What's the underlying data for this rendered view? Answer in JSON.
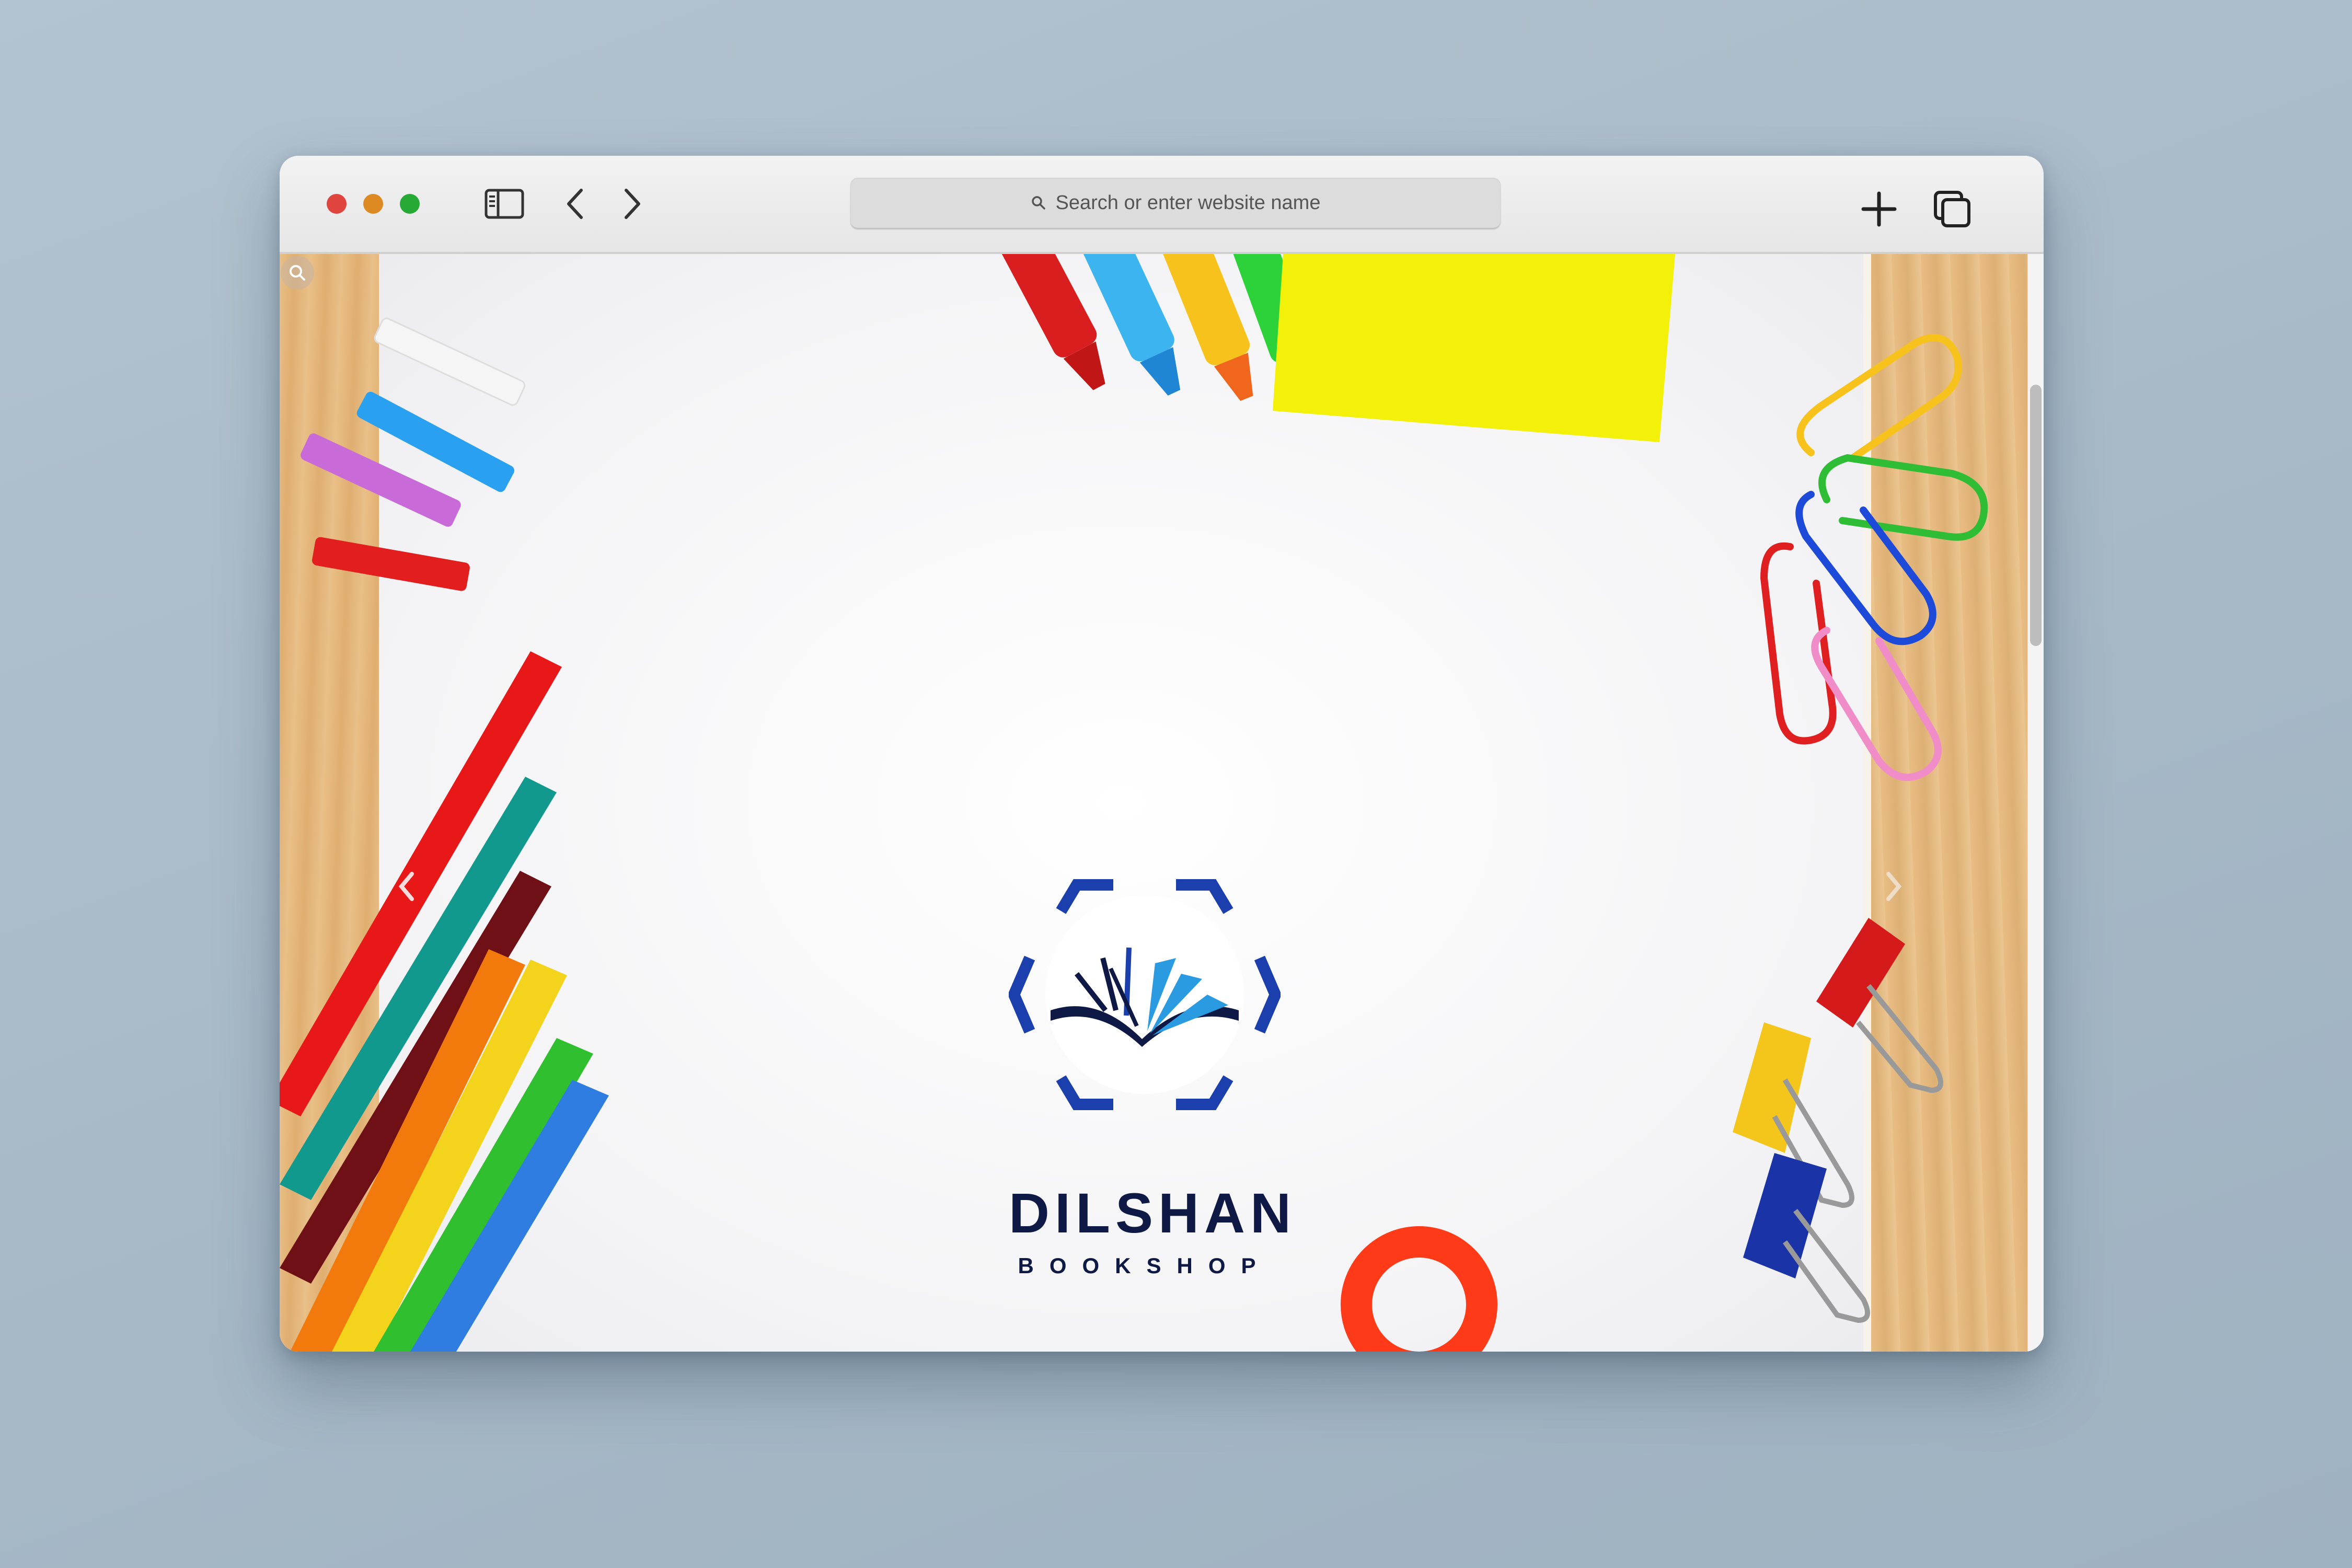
{
  "browser": {
    "address_placeholder": "Search or enter website name",
    "traffic_lights": [
      "#e0443e",
      "#de8a23",
      "#27aa35"
    ]
  },
  "page": {
    "brand_name": "DILSHAN",
    "brand_subtitle": "BOOKSHOP",
    "colors": {
      "brand_navy": "#0e1a45",
      "brand_blue": "#1c3fae",
      "brand_light_blue": "#2a9be0"
    }
  }
}
